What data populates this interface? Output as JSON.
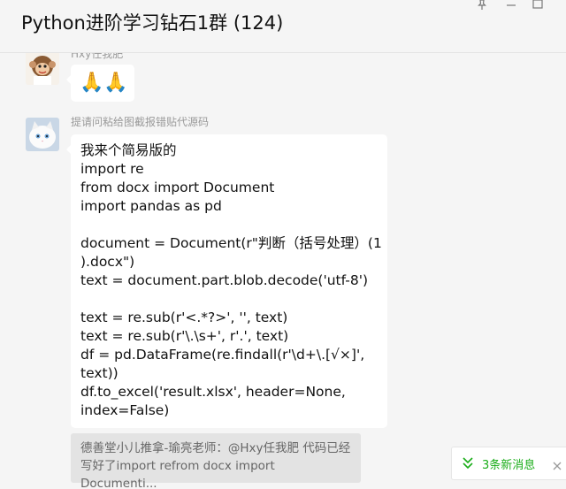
{
  "window": {
    "title": "Python进阶学习钻石1群 (124)",
    "pin_icon": "pin-icon",
    "minimize_icon": "minimize-icon",
    "close_icon": "close-icon"
  },
  "messages": [
    {
      "sender": "Hxy任我肥",
      "avatar": "monkey-avatar",
      "content": "🙏🙏"
    },
    {
      "sender": "提请问粘给图截报错贴代源码",
      "avatar": "white-cat-avatar",
      "content": "我来个简易版的\nimport re\nfrom docx import Document\nimport pandas as pd\n\ndocument = Document(r\"判断（括号处理）(1\n).docx\")\ntext = document.part.blob.decode('utf-8')\n\ntext = re.sub(r'<.*?>', '', text)\ntext = re.sub(r'\\.\\s+', r'.', text)\ndf = pd.DataFrame(re.findall(r'\\d+\\.[√×]',\ntext))\ndf.to_excel('result.xlsx', header=None,\nindex=False)"
    }
  ],
  "quote": {
    "text": "德善堂小儿推拿-瑜亮老师：@Hxy任我肥 代码已经写好了import refrom docx import Documenti..."
  },
  "new_messages": {
    "label": "3条新消息",
    "icon": "double-chevron-down-icon",
    "accent": "#1aad19"
  }
}
